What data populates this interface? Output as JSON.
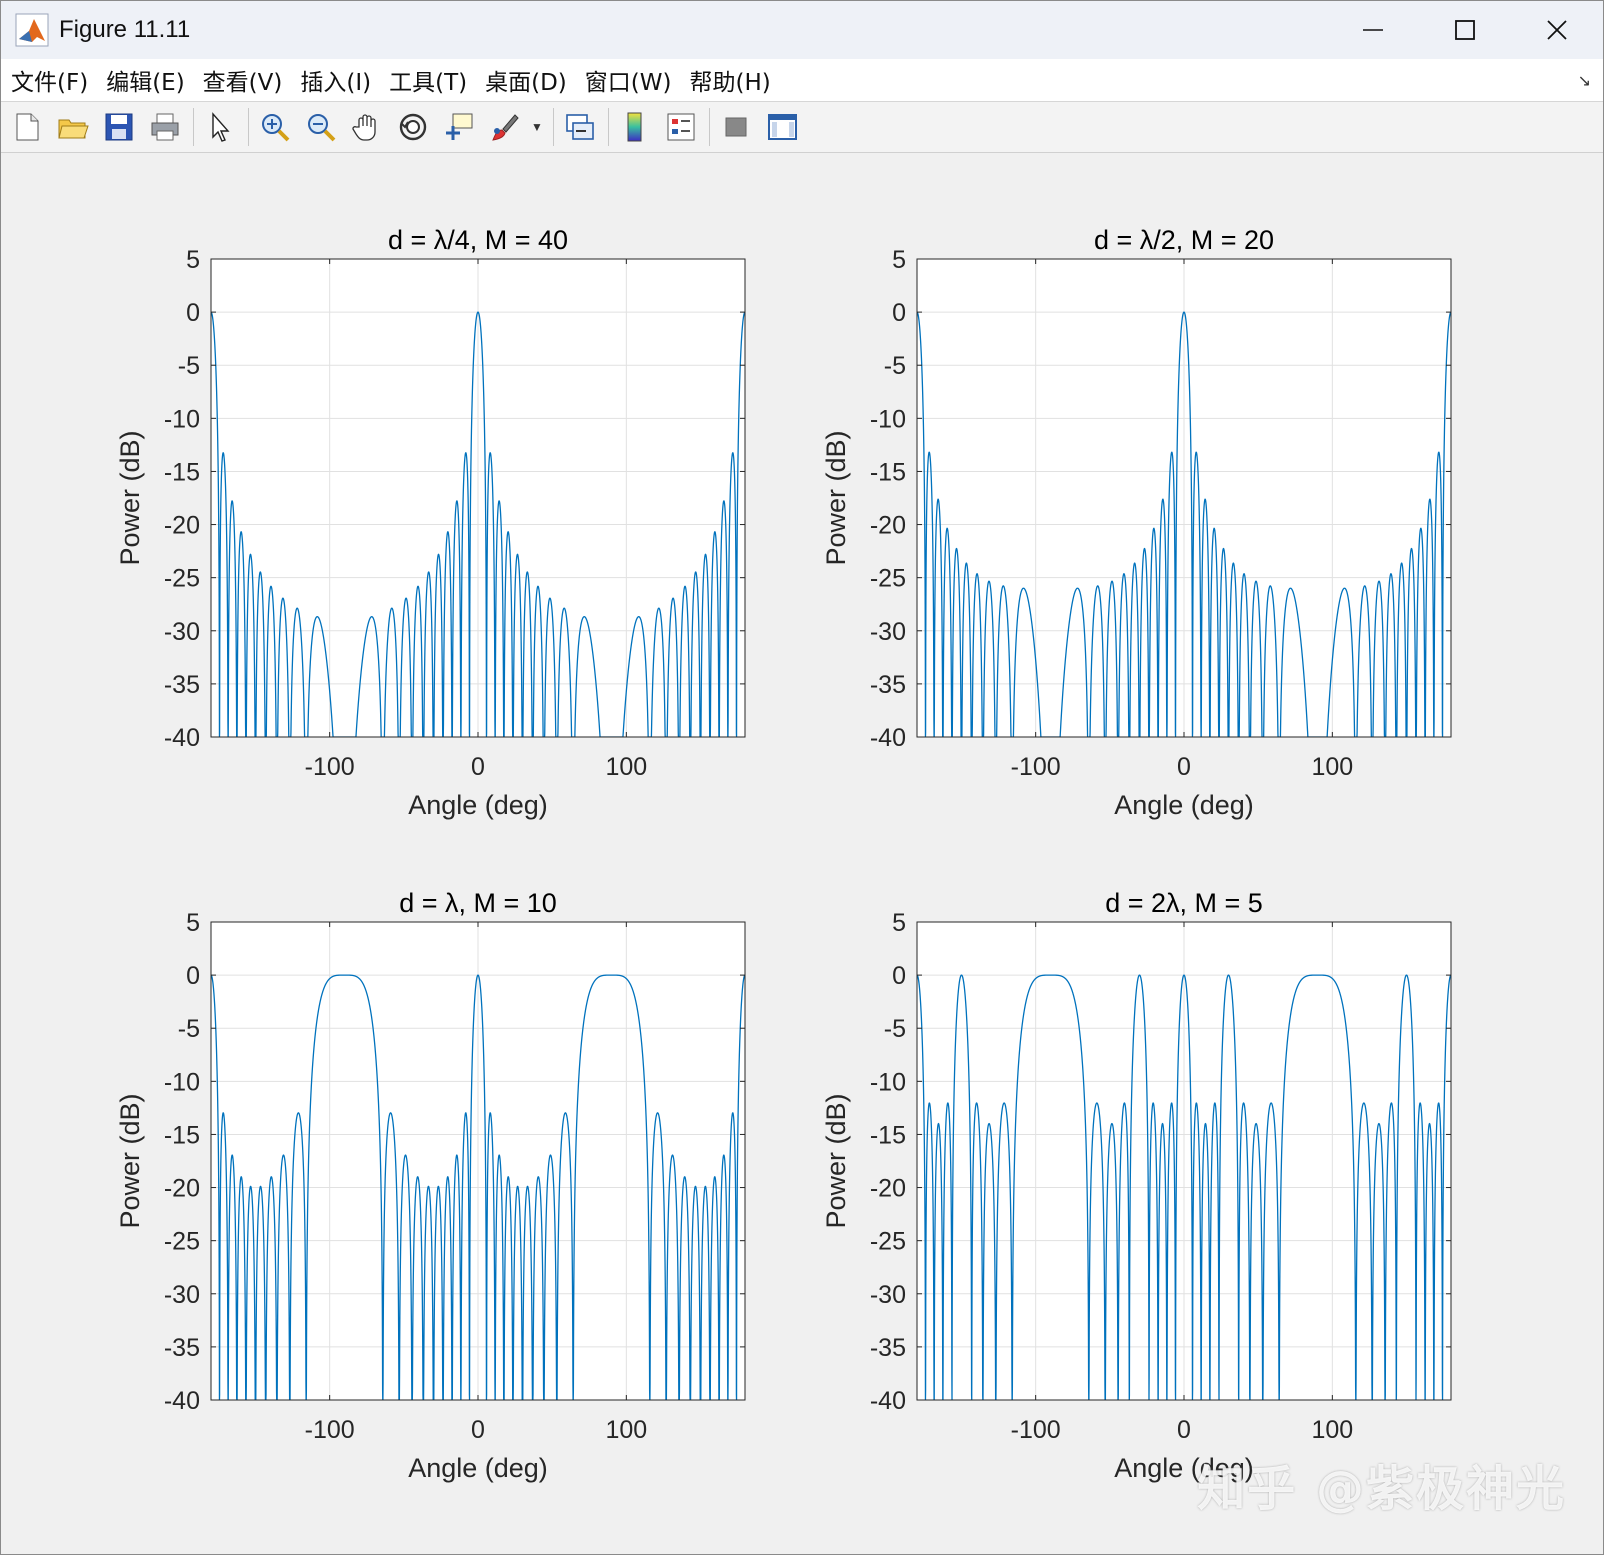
{
  "window": {
    "title": "Figure 11.11"
  },
  "menu": {
    "items": [
      "文件(F)",
      "编辑(E)",
      "查看(V)",
      "插入(I)",
      "工具(T)",
      "桌面(D)",
      "窗口(W)",
      "帮助(H)"
    ]
  },
  "toolbar": {
    "icons": [
      "new-figure-icon",
      "open-file-icon",
      "save-icon",
      "print-icon",
      "edit-plot-arrow-icon",
      "zoom-in-icon",
      "zoom-out-icon",
      "pan-hand-icon",
      "rotate-3d-icon",
      "data-cursor-icon",
      "brush-icon",
      "link-plot-icon",
      "colorbar-icon",
      "legend-icon",
      "hide-plot-tools-icon",
      "show-plot-tools-icon"
    ]
  },
  "watermark": "知乎 @紫极神光",
  "chart_data": [
    {
      "type": "line",
      "title": "d = λ/4, M = 40",
      "xlabel": "Angle (deg)",
      "ylabel": "Power (dB)",
      "xlim": [
        -180,
        180
      ],
      "ylim": [
        -40,
        5
      ],
      "xticks": [
        "-100",
        "0",
        "100"
      ],
      "yticks": [
        "5",
        "0",
        "-5",
        "-10",
        "-15",
        "-20",
        "-25",
        "-30",
        "-35",
        "-40"
      ],
      "grid": true,
      "color": "#0072bd",
      "model": {
        "M": 40,
        "d_over_lambda": 0.25
      }
    },
    {
      "type": "line",
      "title": "d = λ/2, M = 20",
      "xlabel": "Angle (deg)",
      "ylabel": "Power (dB)",
      "xlim": [
        -180,
        180
      ],
      "ylim": [
        -40,
        5
      ],
      "xticks": [
        "-100",
        "0",
        "100"
      ],
      "yticks": [
        "5",
        "0",
        "-5",
        "-10",
        "-15",
        "-20",
        "-25",
        "-30",
        "-35",
        "-40"
      ],
      "grid": true,
      "color": "#0072bd",
      "model": {
        "M": 20,
        "d_over_lambda": 0.5
      }
    },
    {
      "type": "line",
      "title": "d = λ, M = 10",
      "xlabel": "Angle (deg)",
      "ylabel": "Power (dB)",
      "xlim": [
        -180,
        180
      ],
      "ylim": [
        -40,
        5
      ],
      "xticks": [
        "-100",
        "0",
        "100"
      ],
      "yticks": [
        "5",
        "0",
        "-5",
        "-10",
        "-15",
        "-20",
        "-25",
        "-30",
        "-35",
        "-40"
      ],
      "grid": true,
      "color": "#0072bd",
      "model": {
        "M": 10,
        "d_over_lambda": 1
      }
    },
    {
      "type": "line",
      "title": "d = 2λ, M = 5",
      "xlabel": "Angle (deg)",
      "ylabel": "Power (dB)",
      "xlim": [
        -180,
        180
      ],
      "ylim": [
        -40,
        5
      ],
      "xticks": [
        "-100",
        "0",
        "100"
      ],
      "yticks": [
        "5",
        "0",
        "-5",
        "-10",
        "-15",
        "-20",
        "-25",
        "-30",
        "-35",
        "-40"
      ],
      "grid": true,
      "color": "#0072bd",
      "model": {
        "M": 5,
        "d_over_lambda": 2
      }
    }
  ]
}
